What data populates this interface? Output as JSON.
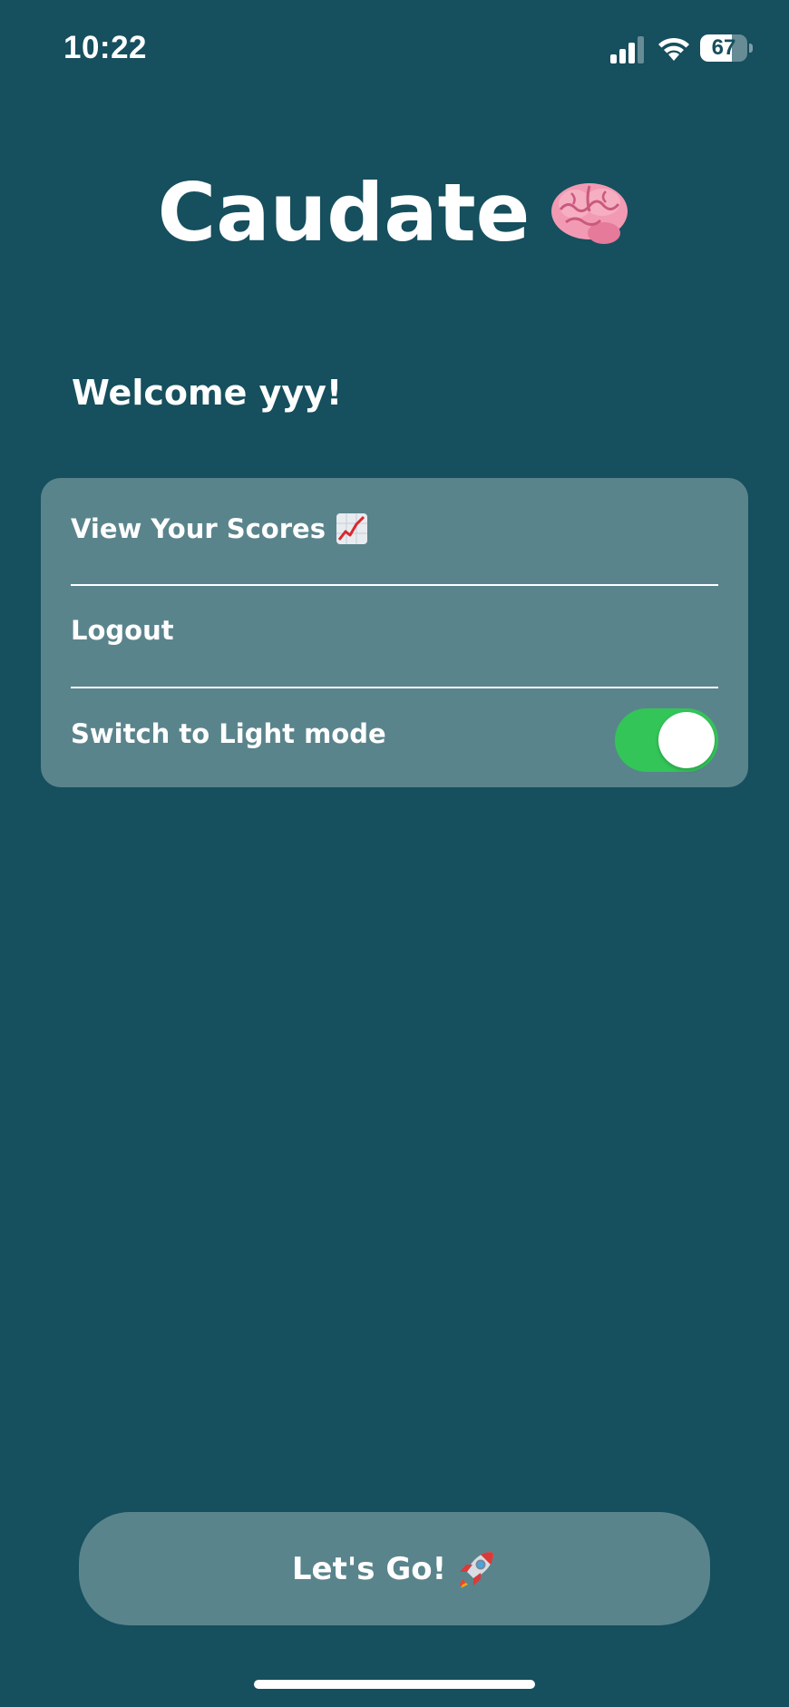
{
  "status_bar": {
    "time": "10:22",
    "battery_level": "67",
    "battery_fraction": 0.67
  },
  "app": {
    "title": "Caudate",
    "title_icon": "brain-icon"
  },
  "welcome_text": "Welcome yyy!",
  "menu": {
    "scores_label": "View Your Scores",
    "scores_icon": "chart-increasing-icon",
    "logout_label": "Logout",
    "theme_label": "Switch to Light mode",
    "theme_toggle_on": true
  },
  "go_button": {
    "label": "Let's Go!",
    "icon": "rocket-icon"
  },
  "colors": {
    "background": "#164f5e",
    "card": "#5a848c",
    "toggle_on": "#33c558",
    "text": "#ffffff"
  }
}
